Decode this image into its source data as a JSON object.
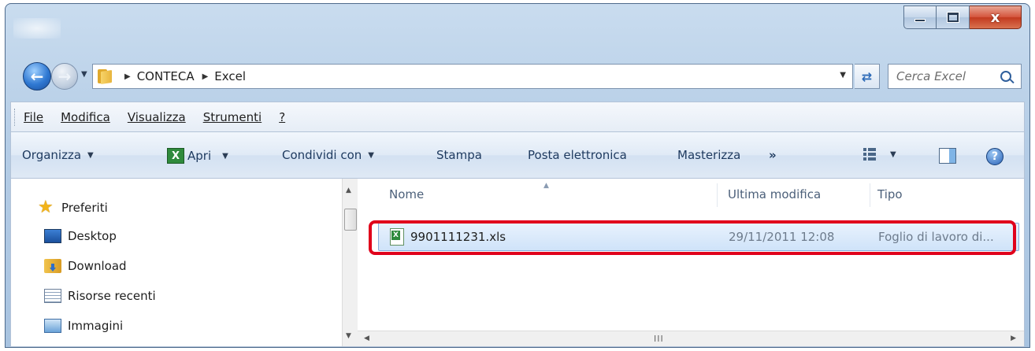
{
  "window": {
    "controls": {
      "minimize_icon": "minimize-icon",
      "maximize_icon": "maximize-icon",
      "close_label": "x"
    }
  },
  "address": {
    "breadcrumbs": [
      "CONTECA",
      "Excel"
    ],
    "folder_icon": "folder-icon"
  },
  "search": {
    "placeholder": "Cerca Excel"
  },
  "menu": {
    "items": [
      "File",
      "Modifica",
      "Visualizza",
      "Strumenti",
      "?"
    ]
  },
  "toolbar": {
    "organize_label": "Organizza",
    "open_label": "Apri",
    "share_label": "Condividi con",
    "print_label": "Stampa",
    "email_label": "Posta elettronica",
    "burn_label": "Masterizza",
    "more_label": "»",
    "help_label": "?"
  },
  "navpane": {
    "favorites_label": "Preferiti",
    "items": [
      "Desktop",
      "Download",
      "Risorse recenti",
      "Immagini"
    ]
  },
  "filelist": {
    "columns": [
      "Nome",
      "Ultima modifica",
      "Tipo"
    ],
    "rows": [
      {
        "name": "9901111231.xls",
        "modified": "29/11/2011 12:08",
        "type": "Foglio di lavoro di..."
      }
    ],
    "highlight_color": "#e0001b"
  },
  "scrollbar": {
    "grip_label": "III"
  }
}
